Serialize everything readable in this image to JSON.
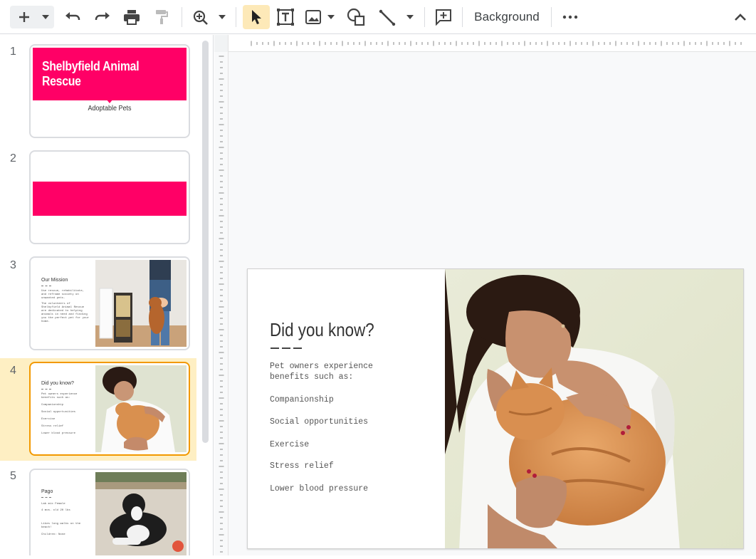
{
  "toolbar": {
    "background_label": "Background",
    "icons": [
      "add-icon",
      "dropdown-icon",
      "undo-icon",
      "redo-icon",
      "print-icon",
      "paint-format-icon",
      "zoom-icon",
      "dropdown-icon",
      "select-cursor-icon",
      "text-box-icon",
      "image-icon",
      "dropdown-icon",
      "shape-icon",
      "line-icon",
      "dropdown-icon",
      "new-comment-icon",
      "more-icon",
      "collapse-chevron-icon"
    ]
  },
  "filmstrip": {
    "slides": [
      {
        "number": "1",
        "title": "Shelbyfield Animal Rescue",
        "subtitle": "Adoptable Pets"
      },
      {
        "number": "2"
      },
      {
        "number": "3",
        "title": "Our Mission",
        "lines": [
          "Use rescue, rehabilitate,",
          "and reframe society on",
          "unwanted pets.",
          "",
          "The volunteers of",
          "Shelbyfield Animal Rescue",
          "are dedicated to helping",
          "animals in need and finding",
          "you the perfect pet for your",
          "home."
        ]
      },
      {
        "number": "4",
        "title": "Did you know?",
        "lines": [
          "Pet owners experience",
          "benefits such as:",
          "",
          "Companionship",
          "",
          "Social opportunities",
          "",
          "Exercise",
          "",
          "Stress relief",
          "",
          "Lower blood pressure"
        ]
      },
      {
        "number": "5",
        "title": "Pago",
        "lines": [
          "Lab mix        Female",
          "4 mos. old     20 lbs",
          "",
          "Likes long walks on the",
          "beach!",
          "",
          "Children: None"
        ]
      }
    ],
    "selected_index": 3
  },
  "slide": {
    "title": "Did you know?",
    "intro": [
      "Pet owners experience",
      "benefits such as:"
    ],
    "benefits": [
      "Companionship",
      "Social opportunities",
      "Exercise",
      "Stress relief",
      "Lower blood pressure"
    ]
  },
  "colors": {
    "accent_pink": "#ff0066",
    "selection_orange": "#f29900",
    "selection_bg": "#feefc3",
    "active_tool_bg": "#fde9b8"
  }
}
